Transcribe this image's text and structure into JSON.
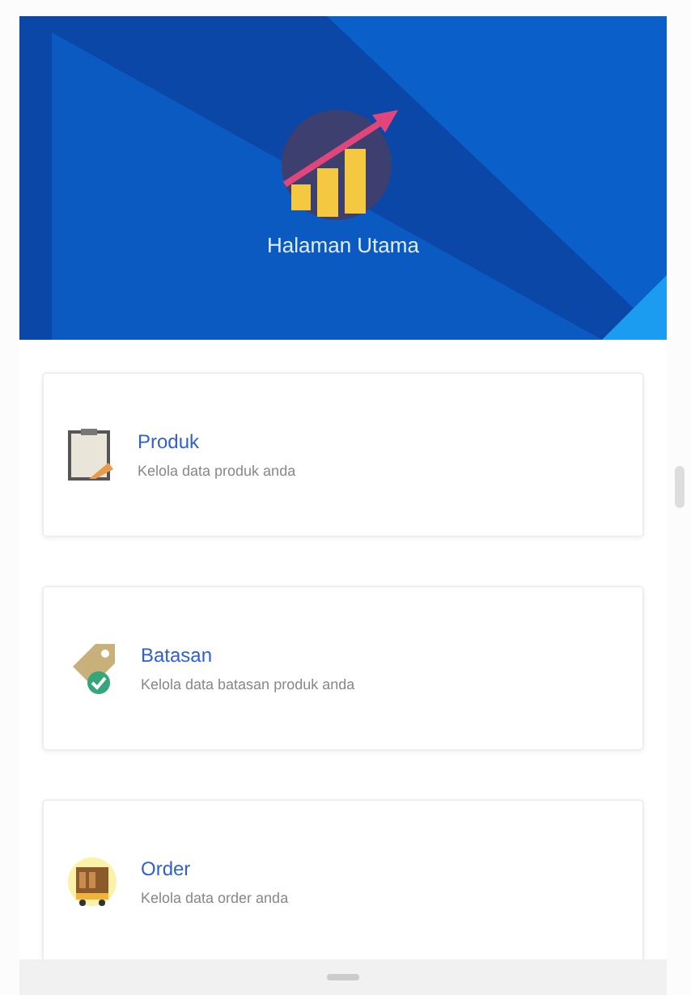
{
  "banner": {
    "title": "Halaman Utama"
  },
  "menu": [
    {
      "kind": "clipboard",
      "title": "Produk",
      "description": "Kelola data produk anda"
    },
    {
      "kind": "tag",
      "title": "Batasan",
      "description": "Kelola data batasan produk anda"
    },
    {
      "kind": "cart",
      "title": "Order",
      "description": "Kelola data order anda"
    }
  ]
}
